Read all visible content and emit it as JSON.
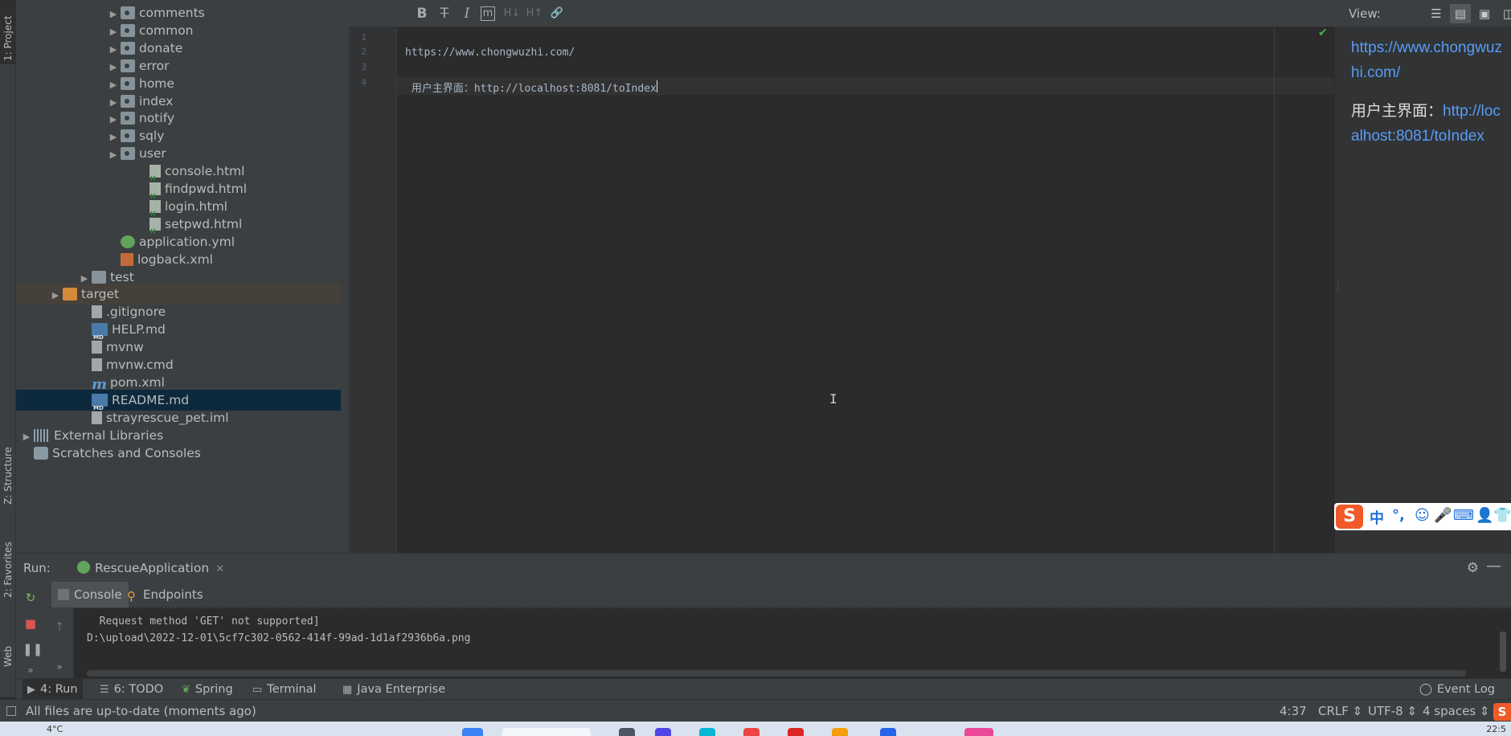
{
  "left_strip": {
    "project_tab": "1: Project",
    "structure_tab": "Z: Structure",
    "favorites_tab": "2: Favorites",
    "web_tab": "Web"
  },
  "project_tree": {
    "rows": [
      {
        "label": "comments",
        "type": "package",
        "indent": 3,
        "expandable": true
      },
      {
        "label": "common",
        "type": "package",
        "indent": 3,
        "expandable": true
      },
      {
        "label": "donate",
        "type": "package",
        "indent": 3,
        "expandable": true
      },
      {
        "label": "error",
        "type": "package",
        "indent": 3,
        "expandable": true
      },
      {
        "label": "home",
        "type": "package",
        "indent": 3,
        "expandable": true
      },
      {
        "label": "index",
        "type": "package",
        "indent": 3,
        "expandable": true
      },
      {
        "label": "notify",
        "type": "package",
        "indent": 3,
        "expandable": true
      },
      {
        "label": "sqly",
        "type": "package",
        "indent": 3,
        "expandable": true
      },
      {
        "label": "user",
        "type": "package",
        "indent": 3,
        "expandable": true
      },
      {
        "label": "console.html",
        "type": "html",
        "indent": 4,
        "expandable": false
      },
      {
        "label": "findpwd.html",
        "type": "html",
        "indent": 4,
        "expandable": false
      },
      {
        "label": "login.html",
        "type": "html",
        "indent": 4,
        "expandable": false
      },
      {
        "label": "setpwd.html",
        "type": "html",
        "indent": 4,
        "expandable": false
      },
      {
        "label": "application.yml",
        "type": "yml",
        "indent": 3,
        "expandable": false
      },
      {
        "label": "logback.xml",
        "type": "xml",
        "indent": 3,
        "expandable": false
      },
      {
        "label": "test",
        "type": "folder",
        "indent": 2,
        "expandable": true
      },
      {
        "label": "target",
        "type": "folder-orange",
        "indent": 1,
        "expandable": true
      },
      {
        "label": ".gitignore",
        "type": "plain",
        "indent": 2,
        "expandable": false
      },
      {
        "label": "HELP.md",
        "type": "md",
        "indent": 2,
        "expandable": false
      },
      {
        "label": "mvnw",
        "type": "plain",
        "indent": 2,
        "expandable": false
      },
      {
        "label": "mvnw.cmd",
        "type": "plain",
        "indent": 2,
        "expandable": false
      },
      {
        "label": "pom.xml",
        "type": "maven",
        "indent": 2,
        "expandable": false
      },
      {
        "label": "README.md",
        "type": "md",
        "indent": 2,
        "expandable": false,
        "selected": true
      },
      {
        "label": "strayrescue_pet.iml",
        "type": "plain",
        "indent": 2,
        "expandable": false
      },
      {
        "label": "External Libraries",
        "type": "libs",
        "indent": 0,
        "expandable": true
      },
      {
        "label": "Scratches and Consoles",
        "type": "scratch",
        "indent": 0,
        "expandable": false
      }
    ]
  },
  "editor": {
    "toolbar": {
      "bold": "B",
      "strike": "T",
      "italic": "I",
      "code": "m",
      "header_down": "H↓",
      "header_up": "H↑",
      "link": "🔗",
      "view_label": "View:"
    },
    "line_numbers": [
      "1",
      "2",
      "3",
      "4"
    ],
    "lines": [
      "",
      "https://www.chongwuzhi.com/",
      "",
      " 用户主界面：http://localhost:8081/toIndex"
    ]
  },
  "preview": {
    "link1": "https://www.chongwuzhi.com/",
    "para2_prefix": "用户主界面：",
    "link2": "http://localhost:8081/toIndex"
  },
  "ime": {
    "logo": "S",
    "items": [
      "中",
      "°,",
      "☺",
      "🎤",
      "⌨",
      "👤",
      "👕"
    ]
  },
  "run": {
    "label": "Run:",
    "tab": "RescueApplication",
    "console_tab": "Console",
    "endpoints_tab": "Endpoints",
    "output": [
      "  Request method 'GET' not supported]",
      "D:\\upload\\2022-12-01\\5cf7c302-0562-414f-99ad-1d1af2936b6a.png"
    ]
  },
  "tool_tabs": {
    "run": "4: Run",
    "todo": "6: TODO",
    "spring": "Spring",
    "terminal": "Terminal",
    "java_enterprise": "Java Enterprise",
    "event_log": "Event Log"
  },
  "status": {
    "message": "All files are up-to-date (moments ago)",
    "position": "4:37",
    "line_sep": "CRLF ⇕",
    "encoding": "UTF-8 ⇕",
    "indent": "4 spaces ⇕",
    "ime_badge": "S"
  },
  "taskbar": {
    "temp": "4°C",
    "clock": "22:5"
  }
}
